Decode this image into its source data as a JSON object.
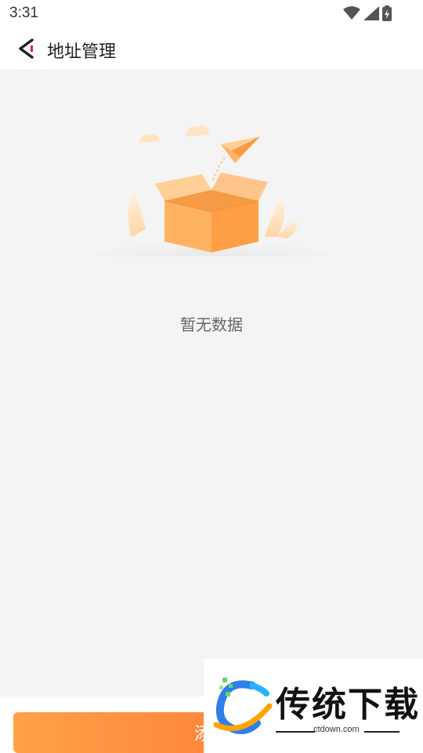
{
  "status_bar": {
    "time": "3:31",
    "icons": [
      "wifi-icon",
      "signal-icon",
      "battery-charging-icon"
    ]
  },
  "header": {
    "back_icon": "back-arrow-icon",
    "title": "地址管理"
  },
  "empty_state": {
    "illustration": "empty-box-with-paper-plane",
    "message": "暂无数据"
  },
  "footer": {
    "add_button_label": "添加"
  },
  "watermark": {
    "title": "传统下载",
    "subtitle": "ctdown.com"
  },
  "colors": {
    "accent_start": "#ffa148",
    "accent_end": "#ff6a2e",
    "content_bg": "#f4f4f4",
    "box_orange": "#ffb262"
  }
}
